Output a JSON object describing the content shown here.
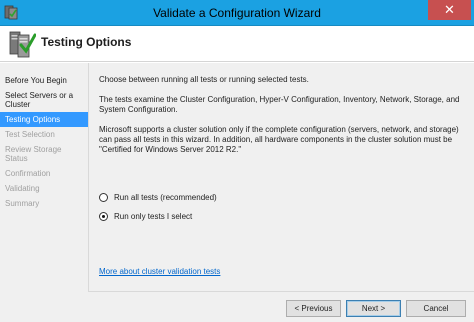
{
  "window": {
    "title": "Validate a Configuration Wizard",
    "close_glyph": "✕"
  },
  "header": {
    "title": "Testing Options"
  },
  "nav": {
    "items": [
      {
        "label": "Before You Begin",
        "state": "normal"
      },
      {
        "label": "Select Servers or a Cluster",
        "state": "normal"
      },
      {
        "label": "Testing Options",
        "state": "active"
      },
      {
        "label": "Test Selection",
        "state": "disabled"
      },
      {
        "label": "Review Storage Status",
        "state": "disabled"
      },
      {
        "label": "Confirmation",
        "state": "disabled"
      },
      {
        "label": "Validating",
        "state": "disabled"
      },
      {
        "label": "Summary",
        "state": "disabled"
      }
    ]
  },
  "content": {
    "intro": "Choose between running all tests or running selected tests.",
    "description": "The tests examine the Cluster Configuration, Hyper-V Configuration, Inventory, Network, Storage, and System Configuration.",
    "support": "Microsoft supports a cluster solution only if the complete configuration (servers, network, and storage) can pass all tests in this wizard. In addition, all hardware components in the cluster solution must be \"Certified for Windows Server 2012 R2.\"",
    "options": [
      {
        "label": "Run all tests (recommended)",
        "checked": false
      },
      {
        "label": "Run only tests I select",
        "checked": true
      }
    ],
    "link": "More about cluster validation tests"
  },
  "buttons": {
    "previous": "< Previous",
    "next": "Next >",
    "cancel": "Cancel"
  },
  "colors": {
    "titlebar": "#1ba1e2",
    "close": "#c75050",
    "selection": "#3399ff",
    "link": "#0066cc"
  }
}
